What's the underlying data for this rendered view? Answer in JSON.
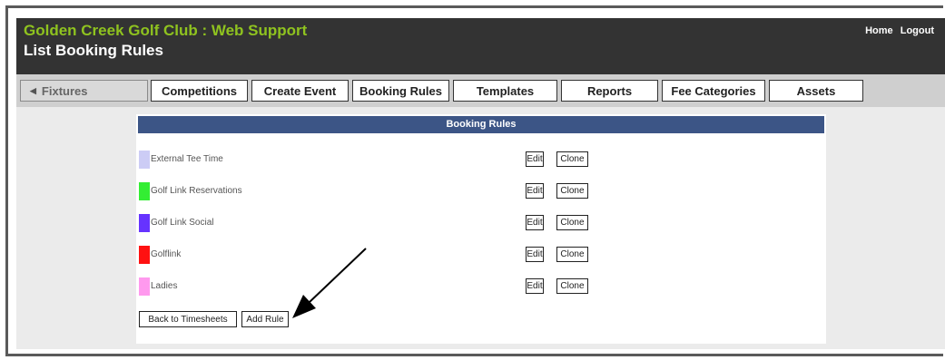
{
  "header": {
    "club_title": "Golden Creek Golf Club : Web Support",
    "page_title": "List Booking Rules",
    "links": [
      "Home",
      "Logout"
    ]
  },
  "nav": {
    "fixtures": "Fixtures",
    "items": [
      "Competitions",
      "Create Event",
      "Booking Rules",
      "Templates",
      "Reports",
      "Fee Categories",
      "Assets"
    ]
  },
  "panel": {
    "title": "Booking Rules",
    "rules": [
      {
        "name": "External Tee Time",
        "color": "#ccccf5"
      },
      {
        "name": "Golf Link Reservations",
        "color": "#33ee33"
      },
      {
        "name": "Golf Link Social",
        "color": "#6633ff"
      },
      {
        "name": "Golflink",
        "color": "#ff1111"
      },
      {
        "name": "Ladies",
        "color": "#ff99ee"
      }
    ],
    "edit_label": "Edit",
    "clone_label": "Clone",
    "back_label": "Back to Timesheets",
    "add_label": "Add Rule"
  }
}
